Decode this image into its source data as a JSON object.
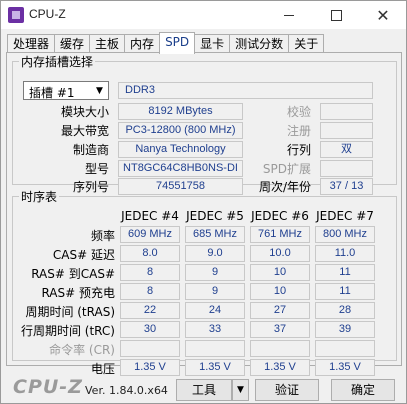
{
  "window": {
    "title": "CPU-Z"
  },
  "tabs": [
    "处理器",
    "缓存",
    "主板",
    "内存",
    "SPD",
    "显卡",
    "测试分数",
    "关于"
  ],
  "active_tab": "SPD",
  "slot_group": {
    "title": "内存插槽选择",
    "slot_select": "插槽 #1",
    "type": "DDR3",
    "labels": {
      "module_size": "模块大小",
      "max_bandwidth": "最大带宽",
      "manufacturer": "制造商",
      "part_number": "型号",
      "serial": "序列号",
      "correction": "校验",
      "registered": "注册",
      "ranks": "行列",
      "spd_ext": "SPD扩展",
      "week_year": "周次/年份"
    },
    "values": {
      "module_size": "8192 MBytes",
      "max_bandwidth": "PC3-12800 (800 MHz)",
      "manufacturer": "Nanya Technology",
      "part_number": "NT8GC64C8HB0NS-DI",
      "serial": "74551758",
      "correction": "",
      "registered": "",
      "ranks": "双",
      "spd_ext": "",
      "week_year": "37 / 13"
    }
  },
  "timing_group": {
    "title": "时序表",
    "columns": [
      "JEDEC #4",
      "JEDEC #5",
      "JEDEC #6",
      "JEDEC #7"
    ],
    "rows": [
      {
        "label": "频率",
        "values": [
          "609 MHz",
          "685 MHz",
          "761 MHz",
          "800 MHz"
        ],
        "disabled": false
      },
      {
        "label": "CAS# 延迟",
        "values": [
          "8.0",
          "9.0",
          "10.0",
          "11.0"
        ],
        "disabled": false
      },
      {
        "label": "RAS# 到CAS#",
        "values": [
          "8",
          "9",
          "10",
          "11"
        ],
        "disabled": false
      },
      {
        "label": "RAS# 预充电",
        "values": [
          "8",
          "9",
          "10",
          "11"
        ],
        "disabled": false
      },
      {
        "label": "周期时间 (tRAS)",
        "values": [
          "22",
          "24",
          "27",
          "28"
        ],
        "disabled": false
      },
      {
        "label": "行周期时间 (tRC)",
        "values": [
          "30",
          "33",
          "37",
          "39"
        ],
        "disabled": false
      },
      {
        "label": "命令率 (CR)",
        "values": [
          "",
          "",
          "",
          ""
        ],
        "disabled": true
      },
      {
        "label": "电压",
        "values": [
          "1.35 V",
          "1.35 V",
          "1.35 V",
          "1.35 V"
        ],
        "disabled": false
      }
    ]
  },
  "footer": {
    "logo": "CPU-Z",
    "version": "Ver. 1.84.0.x64",
    "tools_button": "工具",
    "verify_button": "验证",
    "ok_button": "确定"
  }
}
